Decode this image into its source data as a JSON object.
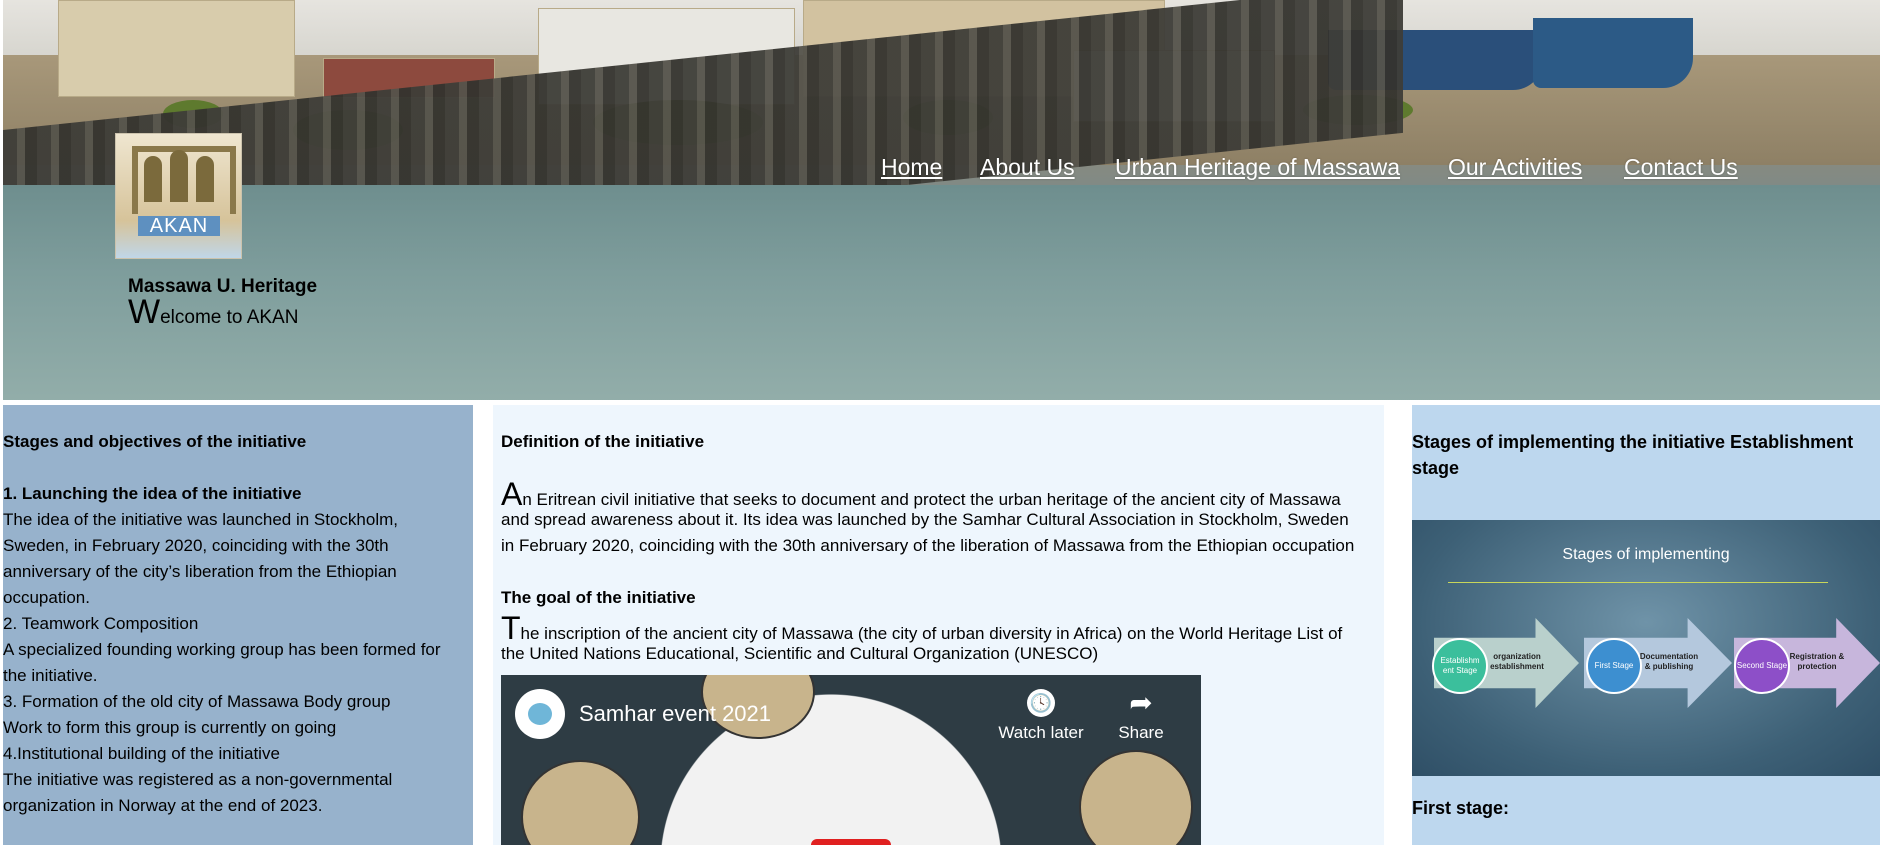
{
  "header": {
    "logo_text": "AKAN",
    "brand": "Massawa U. Heritage",
    "welcome_cap": "W",
    "welcome_rest": "elcome to AKAN"
  },
  "nav": [
    "Home",
    "About Us",
    "Urban Heritage of Massawa",
    "Our Activities",
    "Contact Us"
  ],
  "left": {
    "heading": "Stages and objectives of the initiative",
    "section1_title": "1. Launching the idea of the initiative",
    "lines": [
      "The idea of the initiative was launched in Stockholm,",
      "Sweden, in February 2020, coinciding with the 30th",
      "anniversary of the city’s liberation from the Ethiopian",
      "occupation.",
      "2. Teamwork Composition",
      "A specialized founding working group has been formed for",
      "the initiative.",
      "3. Formation of the old city of Massawa Body group",
      "Work to form this group is currently on going",
      "4.Institutional building of the initiative",
      "The initiative was registered as a non-governmental",
      "organization in Norway at the end of 2023."
    ]
  },
  "middle": {
    "definition_title": "Definition of the initiative",
    "definition_cap": "A",
    "definition_lines": [
      "n Eritrean civil initiative that seeks to document and protect the urban heritage of the ancient city of Massawa",
      "and spread awareness about it. Its idea was launched by the Samhar Cultural Association in Stockholm, Sweden",
      "in February 2020, coinciding with the 30th anniversary of the liberation of Massawa from the Ethiopian occupation"
    ],
    "goal_title": "The goal of the initiative",
    "goal_cap": "T",
    "goal_lines": [
      "he inscription of the ancient city of Massawa (the city of urban diversity in Africa) on the World Heritage List of",
      "the United Nations Educational, Scientific and Cultural Organization (UNESCO)"
    ],
    "video": {
      "title": "Samhar event 2021",
      "watch_later": "Watch later",
      "share": "Share"
    }
  },
  "right": {
    "title": "Stages of implementing the initiative Establishment stage",
    "image": {
      "title": "Stages of implementing",
      "stages": [
        {
          "circle": "Establishm ent Stage",
          "label": "organization establishment",
          "color": "#3bbf9c"
        },
        {
          "circle": "First Stage",
          "label": "Documentation & publishing",
          "color": "#3d8fd0"
        },
        {
          "circle": "Second Stage",
          "label": "Registration & protection",
          "color": "#8d4fc8"
        }
      ]
    },
    "subheading": "First stage:"
  }
}
